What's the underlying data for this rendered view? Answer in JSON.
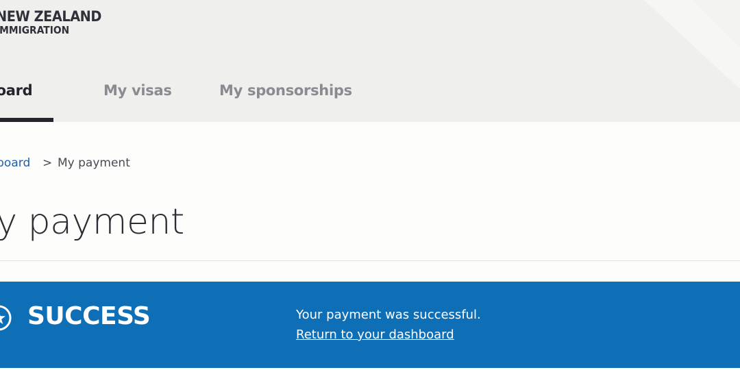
{
  "header": {
    "logo_line1": "NEW ZEALAND",
    "logo_line2": "IMMIGRATION"
  },
  "nav": {
    "tabs": [
      {
        "label": "Dashboard",
        "active": true
      },
      {
        "label": "My visas",
        "active": false
      },
      {
        "label": "My sponsorships",
        "active": false
      }
    ]
  },
  "breadcrumb": {
    "parent": "Dashboard",
    "separator": ">",
    "current": "My payment"
  },
  "page": {
    "title": "My payment"
  },
  "banner": {
    "heading": "SUCCESS",
    "message": "Your payment was successful.",
    "link": "Return to your dashboard",
    "icon": "star-badge-icon"
  },
  "colors": {
    "banner_bg": "#0e6fb7",
    "link": "#1e5fa6",
    "header_bg": "#efefee",
    "active_tab": "#24252c",
    "inactive_tab": "#8a8b91"
  }
}
